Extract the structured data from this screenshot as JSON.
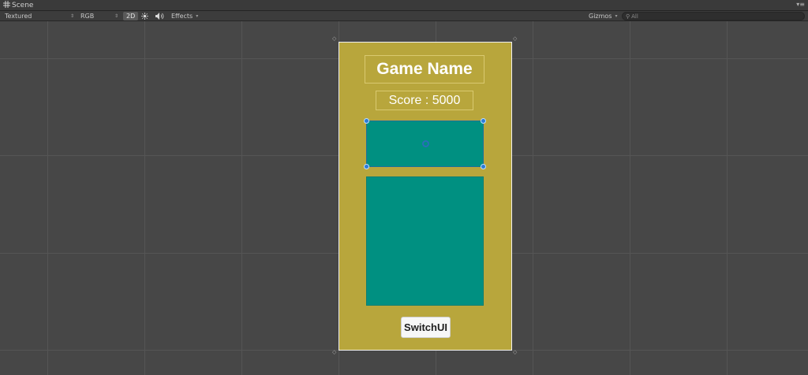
{
  "window": {
    "tab_title": "Scene",
    "tab_icon": "grid-icon",
    "menu_icon": "menu-icon"
  },
  "toolbar": {
    "render_mode": "Textured",
    "color_mode": "RGB",
    "mode_2d": "2D",
    "lighting_icon": "sun-icon",
    "audio_icon": "speaker-icon",
    "effects_label": "Effects",
    "gizmos_label": "Gizmos",
    "search_placeholder": "All",
    "search_icon": "search-icon"
  },
  "canvas": {
    "background_color": "#b8a63c",
    "game_name": "Game Name",
    "score_text": "Score : 5000",
    "panel_color": "#009081",
    "button_label": "SwitchUI"
  }
}
